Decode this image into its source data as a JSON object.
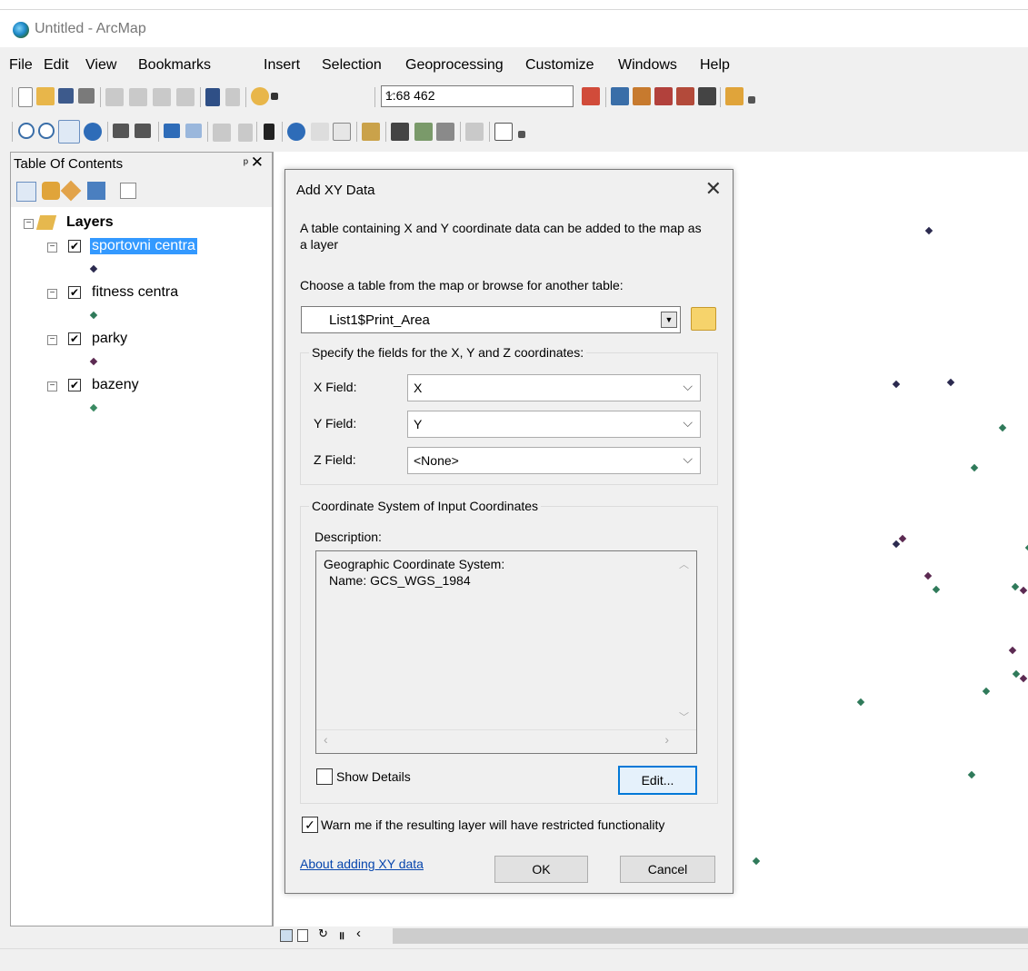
{
  "window": {
    "title": "Untitled - ArcMap"
  },
  "menu": [
    "File",
    "Edit",
    "View",
    "Bookmarks",
    "Insert",
    "Selection",
    "Geoprocessing",
    "Customize",
    "Windows",
    "Help"
  ],
  "toolbar": {
    "scale": "1:68 462"
  },
  "toc": {
    "title": "Table Of Contents",
    "pin": "❁",
    "close": "✕",
    "root": "Layers",
    "layers": [
      {
        "name": "sportovni centra",
        "checked": true,
        "selected": true,
        "symbol_color": "#2b2a4f"
      },
      {
        "name": "fitness centra",
        "checked": true,
        "selected": false,
        "symbol_color": "#2f7a5a"
      },
      {
        "name": "parky",
        "checked": true,
        "selected": false,
        "symbol_color": "#5c2a52"
      },
      {
        "name": "bazeny",
        "checked": true,
        "selected": false,
        "symbol_color": "#3a8a62"
      }
    ]
  },
  "dialog": {
    "title": "Add XY Data",
    "intro": "A table containing X and Y coordinate data can be added to the map as a layer",
    "choose_label": "Choose a table from the map or browse for another table:",
    "table_value": "List1$Print_Area",
    "fields_group": "Specify the fields for the X, Y and Z coordinates:",
    "x_label": "X Field:",
    "x_value": "X",
    "y_label": "Y Field:",
    "y_value": "Y",
    "z_label": "Z Field:",
    "z_value": "<None>",
    "coord_group": "Coordinate System of Input Coordinates",
    "description_label": "Description:",
    "description_line1": "Geographic Coordinate System:",
    "description_line2": "Name: GCS_WGS_1984",
    "show_details": "Show Details",
    "edit": "Edit...",
    "warn": "Warn me if the resulting layer will have restricted functionality",
    "about_link": "About adding XY data",
    "ok": "OK",
    "cancel": "Cancel"
  },
  "map_colors": {
    "dark": "#2b2a4f",
    "green": "#2f7a5a",
    "purple": "#5c2a52"
  }
}
